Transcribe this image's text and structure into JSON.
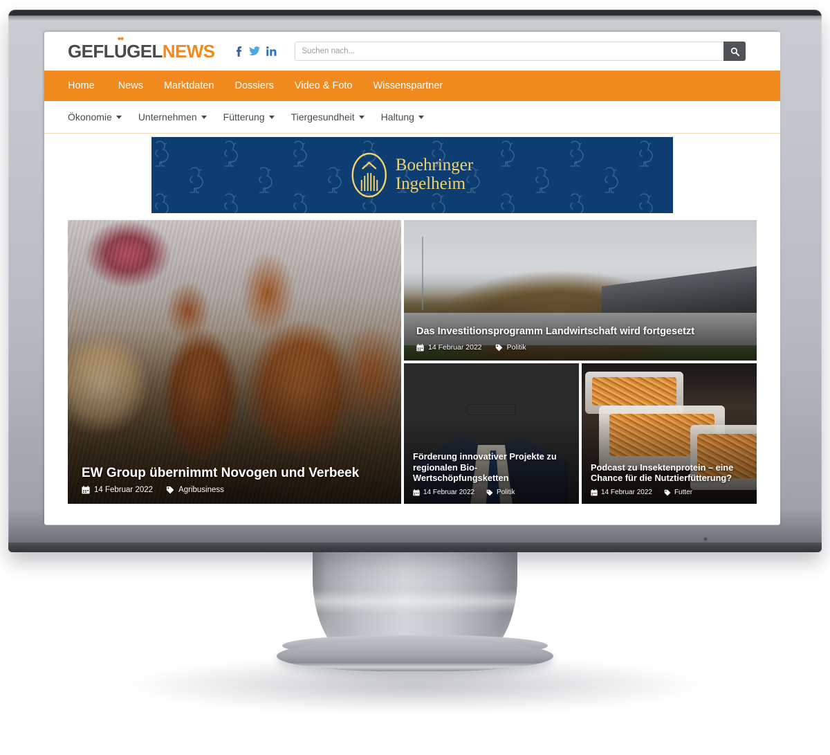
{
  "device": {
    "type": "desktop-monitor",
    "bezel_color": "#b7bac0",
    "top_edge_color": "#2b2d30"
  },
  "site": {
    "logo": {
      "part1": "GEFL",
      "umlaut": "U",
      "part2": "GEL",
      "part3": "NEWS",
      "full": "GEFLÜGELNEWS"
    },
    "colors": {
      "accent_orange": "#F08A1E",
      "logo_gray": "#4A4A4A",
      "banner_navy": "#0E3D72",
      "banner_gold": "#F3D26A",
      "search_button": "#4F5358"
    },
    "social": [
      {
        "name": "facebook",
        "icon": "facebook-icon",
        "label": "f"
      },
      {
        "name": "twitter",
        "icon": "twitter-icon",
        "label": "t"
      },
      {
        "name": "linkedin",
        "icon": "linkedin-icon",
        "label": "in"
      }
    ],
    "search": {
      "placeholder": "Suchen nach...",
      "value": "",
      "button_icon": "search-icon"
    }
  },
  "nav_primary": [
    {
      "label": "Home"
    },
    {
      "label": "News"
    },
    {
      "label": "Marktdaten"
    },
    {
      "label": "Dossiers"
    },
    {
      "label": "Video & Foto"
    },
    {
      "label": "Wissenspartner"
    }
  ],
  "nav_secondary": [
    {
      "label": "Ökonomie",
      "has_dropdown": true
    },
    {
      "label": "Unternehmen",
      "has_dropdown": true
    },
    {
      "label": "Fütterung",
      "has_dropdown": true
    },
    {
      "label": "Tiergesundheit",
      "has_dropdown": true
    },
    {
      "label": "Haltung",
      "has_dropdown": true
    }
  ],
  "banner_ad": {
    "advertiser": "Boehringer Ingelheim",
    "line1": "Boehringer",
    "line2": "Ingelheim",
    "background": "#0E3D72",
    "pattern": "chicken-outline-pattern"
  },
  "articles": {
    "hero": {
      "title": "EW Group übernimmt Novogen und Verbeek",
      "date": "14 Februar 2022",
      "category": "Agribusiness",
      "image_alt": "brown laying hens in a barn"
    },
    "top_right": {
      "title": "Das Investitionsprogramm Landwirtschaft wird fortgesetzt",
      "date": "14 Februar 2022",
      "category": "Politik",
      "image_alt": "large manure pile behind a concrete wall next to a barn"
    },
    "bottom_left": {
      "title": "Förderung innovativer Projekte zu regionalen Bio-Wertschöpfungsketten",
      "date": "14 Februar 2022",
      "category": "Politik",
      "image_alt": "politician in dark suit with glasses"
    },
    "bottom_right": {
      "title": "Podcast zu Insektenprotein – eine Chance für die Nutztierfütterung?",
      "date": "14 Februar 2022",
      "category": "Futter",
      "image_alt": "plastic tubs filled with mealworms"
    }
  },
  "icons": {
    "calendar": "calendar-icon",
    "tag": "tag-icon",
    "search": "search-icon",
    "chevron_down": "chevron-down-icon"
  }
}
